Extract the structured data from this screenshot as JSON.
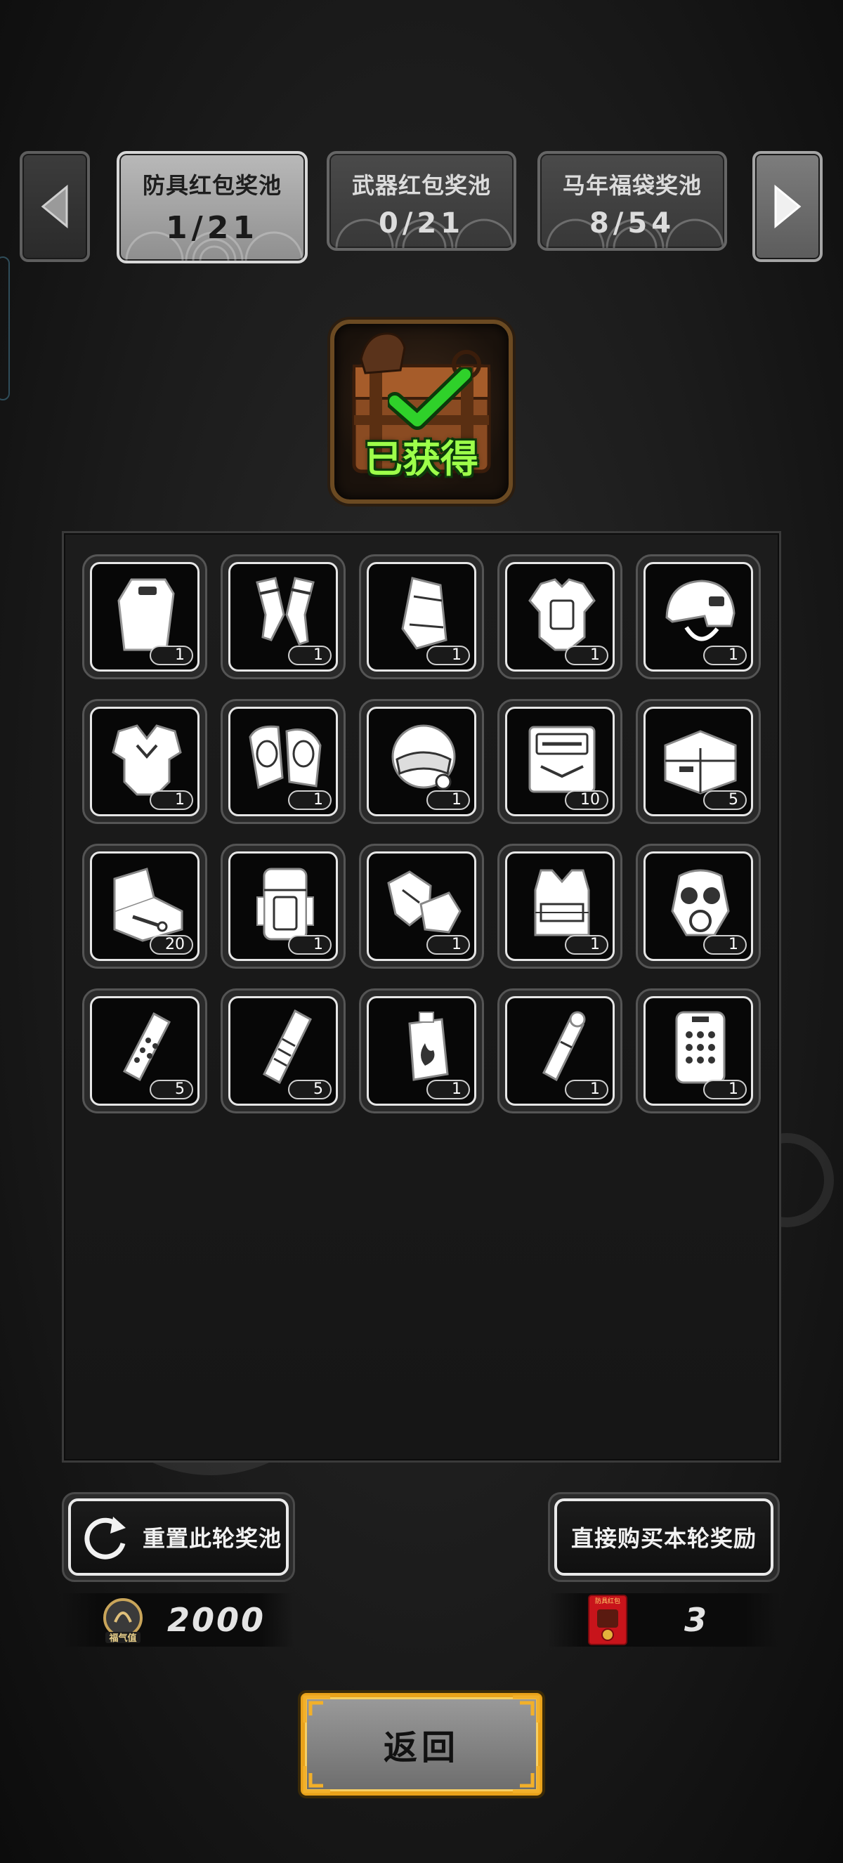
{
  "tabs": [
    {
      "label": "防具红包奖池",
      "count": "1/21",
      "active": true
    },
    {
      "label": "武器红包奖池",
      "count": "0/21",
      "active": false
    },
    {
      "label": "马年福袋奖池",
      "count": "8/54",
      "active": false
    }
  ],
  "chest": {
    "status_label": "已获得"
  },
  "items": [
    {
      "icon": "riot-shield-icon",
      "qty": "1"
    },
    {
      "icon": "shin-guards-icon",
      "qty": "1"
    },
    {
      "icon": "arm-guard-icon",
      "qty": "1"
    },
    {
      "icon": "body-armor-icon",
      "qty": "1"
    },
    {
      "icon": "tactical-helmet-icon",
      "qty": "1"
    },
    {
      "icon": "armored-vest-icon",
      "qty": "1"
    },
    {
      "icon": "knee-pads-icon",
      "qty": "1"
    },
    {
      "icon": "visor-helmet-icon",
      "qty": "1"
    },
    {
      "icon": "repair-kit-icon",
      "qty": "10"
    },
    {
      "icon": "toolbox-icon",
      "qty": "5"
    },
    {
      "icon": "tool-case-icon",
      "qty": "20"
    },
    {
      "icon": "backpack-icon",
      "qty": "1"
    },
    {
      "icon": "gloves-icon",
      "qty": "1"
    },
    {
      "icon": "plate-carrier-icon",
      "qty": "1"
    },
    {
      "icon": "gas-mask-icon",
      "qty": "1"
    },
    {
      "icon": "frag-grenade-icon",
      "qty": "5"
    },
    {
      "icon": "stun-grenade-icon",
      "qty": "5"
    },
    {
      "icon": "incendiary-grenade-icon",
      "qty": "1"
    },
    {
      "icon": "smoke-grenade-icon",
      "qty": "1"
    },
    {
      "icon": "heavy-shield-icon",
      "qty": "1"
    }
  ],
  "actions": {
    "reset_label": "重置此轮奖池",
    "buy_label": "直接购买本轮奖励"
  },
  "currencies": {
    "fortune": {
      "icon_label": "福气值",
      "value": "2000"
    },
    "red_packet": {
      "icon_label": "防具红包",
      "value": "3"
    }
  },
  "return_label": "返回",
  "colors": {
    "accent_gold": "#e9a21a",
    "chest_text_green": "#9dff4a",
    "check_green": "#2fd12a",
    "packet_red": "#c8141b"
  }
}
